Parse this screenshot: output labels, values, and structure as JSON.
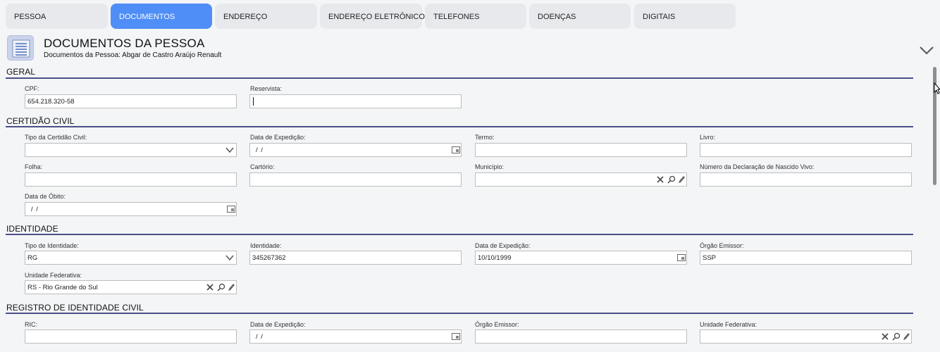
{
  "tabs": [
    {
      "label": "PESSOA",
      "active": false
    },
    {
      "label": "DOCUMENTOS",
      "active": true
    },
    {
      "label": "ENDEREÇO",
      "active": false
    },
    {
      "label": "ENDEREÇO ELETRÔNICO",
      "active": false
    },
    {
      "label": "TELEFONES",
      "active": false
    },
    {
      "label": "DOENÇAS",
      "active": false
    },
    {
      "label": "DIGITAIS",
      "active": false
    }
  ],
  "header": {
    "title": "DOCUMENTOS DA PESSOA",
    "subtitle": "Documentos da Pessoa: Abgar de Castro Araújo Renault"
  },
  "sections": {
    "geral": {
      "title": "GERAL",
      "cpf": {
        "label": "CPF:",
        "value": "654.218.320-58"
      },
      "reservista": {
        "label": "Reservista:",
        "value": ""
      }
    },
    "certidao": {
      "title": "CERTIDÃO CIVIL",
      "tipo": {
        "label": "Tipo da Certidão Civil:",
        "value": ""
      },
      "data_expedicao": {
        "label": "Data de Expedição:",
        "value": " /  /"
      },
      "termo": {
        "label": "Termo:",
        "value": ""
      },
      "livro": {
        "label": "Livro:",
        "value": ""
      },
      "folha": {
        "label": "Folha:",
        "value": ""
      },
      "cartorio": {
        "label": "Cartório:",
        "value": ""
      },
      "municipio": {
        "label": "Município:",
        "value": ""
      },
      "nascido_vivo": {
        "label": "Número da Declaração de Nascido Vivo:",
        "value": ""
      },
      "data_obito": {
        "label": "Data de Óbito:",
        "value": " /  /"
      }
    },
    "identidade": {
      "title": "IDENTIDADE",
      "tipo": {
        "label": "Tipo de Identidade:",
        "value": "RG"
      },
      "identidade": {
        "label": "Identidade:",
        "value": "345267362"
      },
      "data_expedicao": {
        "label": "Data de Expedição:",
        "value": "10/10/1999"
      },
      "orgao": {
        "label": "Órgão Emissor:",
        "value": "SSP"
      },
      "uf": {
        "label": "Unidade Federativa:",
        "value": "RS - Rio Grande do Sul"
      }
    },
    "ric": {
      "title": "REGISTRO DE IDENTIDADE CIVIL",
      "ric": {
        "label": "RIC:",
        "value": ""
      },
      "data_expedicao": {
        "label": "Data de Expedição:",
        "value": " /  /"
      },
      "orgao": {
        "label": "Órgão Emissor:",
        "value": ""
      },
      "uf": {
        "label": "Unidade Federativa:",
        "value": ""
      }
    }
  },
  "icons": {
    "page": "document-list-icon",
    "collapse": "chevron-down-icon",
    "calendar": "calendar-icon",
    "clear": "clear-x-icon",
    "search": "search-icon",
    "edit": "pencil-icon"
  },
  "colors": {
    "accent": "#4f8ef7",
    "section_line": "#4a4f86"
  }
}
